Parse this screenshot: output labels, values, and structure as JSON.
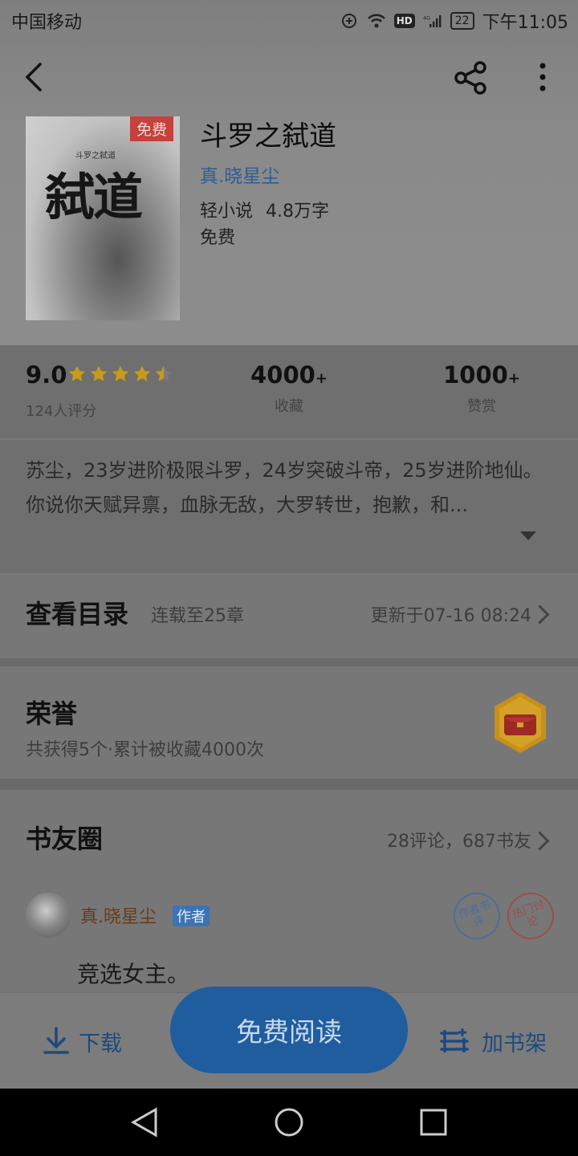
{
  "status_bar": {
    "carrier": "中国移动",
    "network": "4G",
    "battery": "22",
    "time": "下午11:05"
  },
  "book": {
    "cover_title": "弑道",
    "cover_small_text": "斗罗之弑道",
    "free_tag": "免费",
    "title": "斗罗之弑道",
    "author": "真.晓星尘",
    "category": "轻小说",
    "word_count": "4.8万字",
    "price": "免费"
  },
  "stats": {
    "score": "9.0",
    "rating_stars": 4.5,
    "score_label": "124人评分",
    "favorites": "4000",
    "favorites_label": "收藏",
    "rewards": "1000",
    "rewards_label": "赞赏",
    "plus": "+"
  },
  "description": "苏尘，23岁进阶极限斗罗，24岁突破斗帝，25岁进阶地仙。你说你天赋异禀，血脉无敌，大罗转世，抱歉，和...",
  "catalog": {
    "title": "查看目录",
    "progress": "连载至25章",
    "updated": "更新于07-16 08:24"
  },
  "honor": {
    "title": "荣誉",
    "summary": "共获得5个·累计被收藏4000次"
  },
  "circle": {
    "title": "书友圈",
    "stats": "28评论，687书友",
    "post": {
      "user": "真.晓星尘",
      "tag": "作者",
      "stamp1": "作者书评",
      "stamp2": "热门讨论",
      "text": "竞选女主。"
    }
  },
  "bottom": {
    "download": "下载",
    "read": "免费阅读",
    "add_shelf": "加书架"
  },
  "colors": {
    "accent": "#1f5d9f",
    "star": "#c99a1a",
    "free_tag": "#c4413c"
  }
}
